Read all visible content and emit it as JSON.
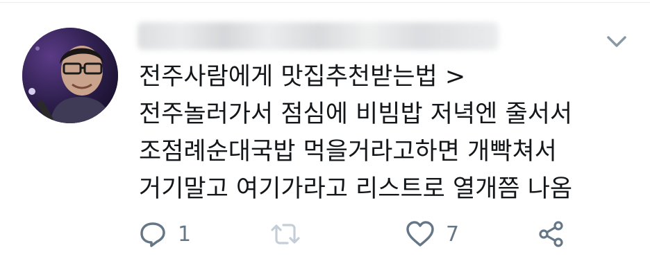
{
  "tweet": {
    "author_blurred": true,
    "lines": [
      "전주사람에게 맛집추천받는법 >",
      "전주놀러가서 점심에 비빔밥 저녁엔 줄서서",
      "조점례순대국밥 먹을거라고하면 개빡쳐서",
      "거기말고 여기가라고 리스트로 열개쯤 나옴"
    ],
    "actions": {
      "reply_icon": "reply-bubble-icon",
      "reply_count": "1",
      "retweet_icon": "retweet-icon",
      "like_icon": "heart-icon",
      "like_count": "7",
      "share_icon": "share-icon"
    },
    "menu_icon": "chevron-down-icon"
  },
  "colors": {
    "text": "#14171a",
    "icon": "#657786",
    "divider": "#e6ecf0",
    "background": "#ffffff"
  }
}
